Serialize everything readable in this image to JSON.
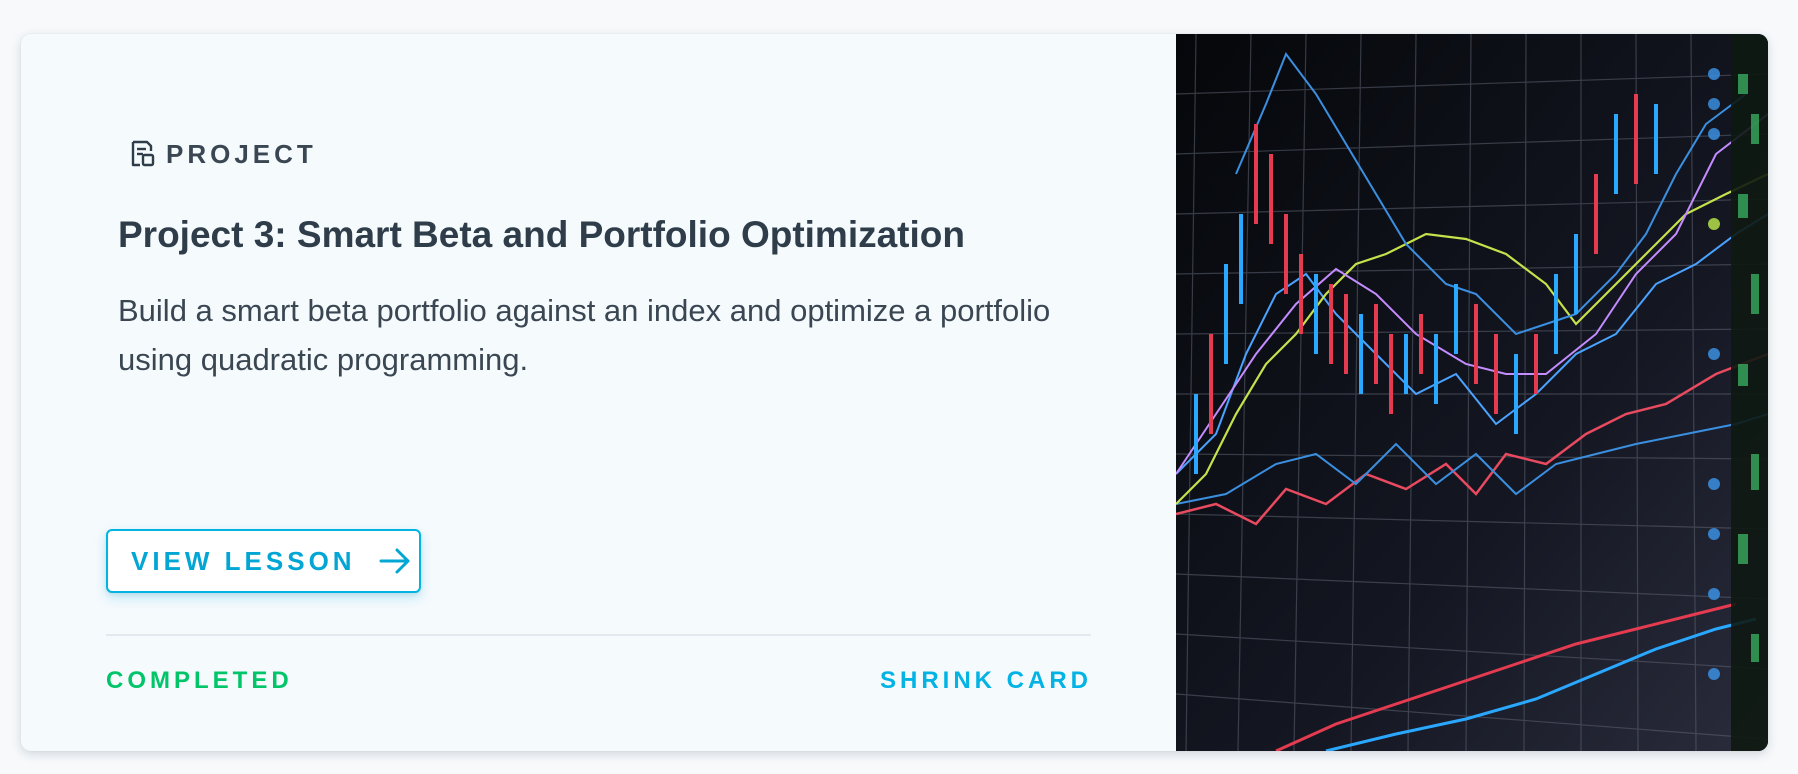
{
  "card": {
    "type_label": "PROJECT",
    "title": "Project 3: Smart Beta and Portfolio Optimization",
    "summary": "Build a smart beta portfolio against an index and optimize a portfolio using quadratic programming.",
    "button_label": "VIEW LESSON",
    "status": "COMPLETED",
    "shrink_label": "SHRINK CARD"
  },
  "icons": {
    "type_icon": "project-document-icon",
    "button_icon": "arrow-right-icon"
  },
  "colors": {
    "accent": "#02b3e4",
    "completed": "#02c56a",
    "text": "#2e3d49",
    "card_bg": "#f5fafd"
  }
}
